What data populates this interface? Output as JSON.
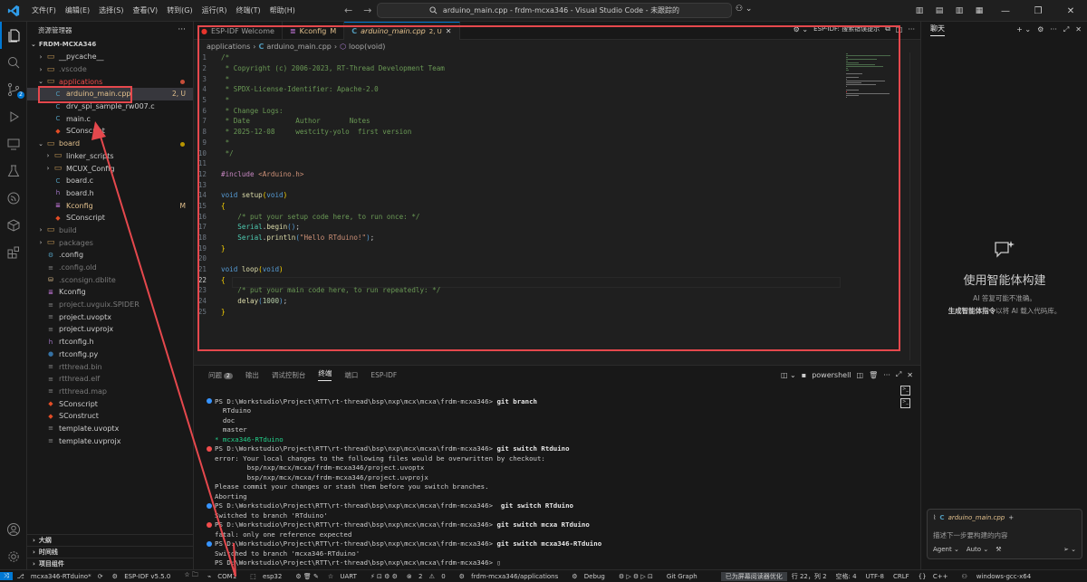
{
  "titlebar": {
    "menus": [
      "文件(F)",
      "编辑(E)",
      "选择(S)",
      "查看(V)",
      "转到(G)",
      "运行(R)",
      "终端(T)",
      "帮助(H)"
    ],
    "command_center": "arduino_main.cpp - frdm-mcxa346 - Visual Studio Code - 未跟踪的"
  },
  "activity": {
    "source_control_badge": "2"
  },
  "sidebar": {
    "title": "资源管理器",
    "root": "FRDM-MCXA346",
    "items": [
      {
        "label": "__pycache__",
        "indent": 1,
        "type": "folder",
        "expanded": false,
        "status": ""
      },
      {
        "label": ".vscode",
        "indent": 1,
        "type": "folder",
        "expanded": false,
        "status": "",
        "dim": true
      },
      {
        "label": "applications",
        "indent": 1,
        "type": "folder",
        "expanded": true,
        "status": "",
        "color": "#f14c4c"
      },
      {
        "label": "arduino_main.cpp",
        "indent": 2,
        "type": "cpp",
        "status": "2, U",
        "color": "#e2c08d",
        "selected": true
      },
      {
        "label": "drv_spi_sample_rw007.c",
        "indent": 2,
        "type": "c",
        "status": ""
      },
      {
        "label": "main.c",
        "indent": 2,
        "type": "c",
        "status": ""
      },
      {
        "label": "SConscript",
        "indent": 2,
        "type": "scons",
        "status": ""
      },
      {
        "label": "board",
        "indent": 1,
        "type": "folder",
        "expanded": true,
        "status": "",
        "color": "#e2c08d"
      },
      {
        "label": "linker_scripts",
        "indent": 2,
        "type": "folder",
        "expanded": false,
        "status": ""
      },
      {
        "label": "MCUX_Config",
        "indent": 2,
        "type": "folder",
        "expanded": false,
        "status": ""
      },
      {
        "label": "board.c",
        "indent": 2,
        "type": "c",
        "status": ""
      },
      {
        "label": "board.h",
        "indent": 2,
        "type": "h",
        "status": ""
      },
      {
        "label": "Kconfig",
        "indent": 2,
        "type": "kconfig",
        "status": "M",
        "color": "#e2c08d"
      },
      {
        "label": "SConscript",
        "indent": 2,
        "type": "scons",
        "status": ""
      },
      {
        "label": "build",
        "indent": 1,
        "type": "folder",
        "expanded": false,
        "status": "",
        "dim": true
      },
      {
        "label": "packages",
        "indent": 1,
        "type": "folder",
        "expanded": false,
        "status": "",
        "dim": true
      },
      {
        "label": ".config",
        "indent": 1,
        "type": "gear",
        "status": ""
      },
      {
        "label": ".config.old",
        "indent": 1,
        "type": "file",
        "status": "",
        "dim": true
      },
      {
        "label": ".sconsign.dblite",
        "indent": 1,
        "type": "db",
        "status": "",
        "dim": true
      },
      {
        "label": "Kconfig",
        "indent": 1,
        "type": "kconfig",
        "status": ""
      },
      {
        "label": "project.uvguix.SPIDER",
        "indent": 1,
        "type": "file",
        "status": "",
        "dim": true
      },
      {
        "label": "project.uvoptx",
        "indent": 1,
        "type": "file",
        "status": ""
      },
      {
        "label": "project.uvprojx",
        "indent": 1,
        "type": "file",
        "status": ""
      },
      {
        "label": "rtconfig.h",
        "indent": 1,
        "type": "h",
        "status": ""
      },
      {
        "label": "rtconfig.py",
        "indent": 1,
        "type": "py",
        "status": ""
      },
      {
        "label": "rtthread.bin",
        "indent": 1,
        "type": "file",
        "status": "",
        "dim": true
      },
      {
        "label": "rtthread.elf",
        "indent": 1,
        "type": "file",
        "status": "",
        "dim": true
      },
      {
        "label": "rtthread.map",
        "indent": 1,
        "type": "file",
        "status": "",
        "dim": true
      },
      {
        "label": "SConscript",
        "indent": 1,
        "type": "scons",
        "status": ""
      },
      {
        "label": "SConstruct",
        "indent": 1,
        "type": "scons",
        "status": ""
      },
      {
        "label": "template.uvoptx",
        "indent": 1,
        "type": "file",
        "status": ""
      },
      {
        "label": "template.uvprojx",
        "indent": 1,
        "type": "file",
        "status": ""
      }
    ],
    "bottom_sections": [
      "大纲",
      "时间线",
      "项目组件"
    ]
  },
  "tabs": [
    {
      "label": "ESP-IDF Welcome",
      "icon": "esp-icon",
      "active": false,
      "status": ""
    },
    {
      "label": "Kconfig",
      "icon": "kconfig-icon",
      "active": false,
      "status": "M"
    },
    {
      "label": "arduino_main.cpp",
      "icon": "cpp-icon",
      "active": true,
      "status": "2, U"
    }
  ],
  "tab_actions": {
    "esp_hint": "ESP-IDF: 搜索错误提示"
  },
  "breadcrumb": {
    "folder": "applications",
    "file": "arduino_main.cpp",
    "symbol": "loop(void)"
  },
  "code": [
    [
      [
        "c-com",
        "/*"
      ]
    ],
    [
      [
        "c-com",
        " * Copyright (c) 2006-2023, RT-Thread Development Team"
      ]
    ],
    [
      [
        "c-com",
        " *"
      ]
    ],
    [
      [
        "c-com",
        " * SPDX-License-Identifier: Apache-2.0"
      ]
    ],
    [
      [
        "c-com",
        " *"
      ]
    ],
    [
      [
        "c-com",
        " * Change Logs:"
      ]
    ],
    [
      [
        "c-com",
        " * Date           Author       Notes"
      ]
    ],
    [
      [
        "c-com",
        " * 2025-12-08     westcity-yolo  first version"
      ]
    ],
    [
      [
        "c-com",
        " *"
      ]
    ],
    [
      [
        "c-com",
        " */"
      ]
    ],
    [],
    [
      [
        "c-inc",
        "#include "
      ],
      [
        "c-str",
        "<Arduino.h>"
      ]
    ],
    [],
    [
      [
        "c-kw",
        "void "
      ],
      [
        "c-fn",
        "setup"
      ],
      [
        "c-paren",
        "("
      ],
      [
        "c-kw",
        "void"
      ],
      [
        "c-paren",
        ")"
      ]
    ],
    [
      [
        "c-paren",
        "{"
      ]
    ],
    [
      [
        "",
        "    "
      ],
      [
        "c-com",
        "/* put your setup code here, to run once: */"
      ]
    ],
    [
      [
        "",
        "    "
      ],
      [
        "c-obj",
        "Serial"
      ],
      [
        "",
        "."
      ],
      [
        "c-fn",
        "begin"
      ],
      [
        "c-kw",
        "()"
      ],
      [
        "",
        ";"
      ]
    ],
    [
      [
        "",
        "    "
      ],
      [
        "c-obj",
        "Serial"
      ],
      [
        "",
        "."
      ],
      [
        "c-fn",
        "println"
      ],
      [
        "c-kw",
        "("
      ],
      [
        "c-str",
        "\"Hello RTduino!\""
      ],
      [
        "c-kw",
        ")"
      ],
      [
        "",
        ";"
      ]
    ],
    [
      [
        "c-paren",
        "}"
      ]
    ],
    [],
    [
      [
        "c-kw",
        "void "
      ],
      [
        "c-fn",
        "loop"
      ],
      [
        "c-paren",
        "("
      ],
      [
        "c-kw",
        "void"
      ],
      [
        "c-paren",
        ")"
      ]
    ],
    [
      [
        "c-paren",
        "{"
      ]
    ],
    [
      [
        "",
        "    "
      ],
      [
        "c-com",
        "/* put your main code here, to run repeatedly: */"
      ]
    ],
    [
      [
        "",
        "    "
      ],
      [
        "c-fn",
        "delay"
      ],
      [
        "c-kw",
        "("
      ],
      [
        "c-num",
        "1000"
      ],
      [
        "c-kw",
        ")"
      ],
      [
        "",
        ";"
      ]
    ],
    [
      [
        "c-paren",
        "}"
      ]
    ]
  ],
  "current_line": 22,
  "panel": {
    "tabs": [
      {
        "label": "问题",
        "badge": "2"
      },
      {
        "label": "输出",
        "badge": ""
      },
      {
        "label": "调试控制台",
        "badge": ""
      },
      {
        "label": "终端",
        "badge": "",
        "active": true
      },
      {
        "label": "端口",
        "badge": ""
      },
      {
        "label": "ESP-IDF",
        "badge": ""
      }
    ],
    "shell": "powershell"
  },
  "terminal": [
    {
      "bullet": "blue",
      "prompt": "PS D:\\Workstudio\\Project\\RTT\\rt-thread\\bsp\\nxp\\mcx\\mcxa\\frdm-mcxa346> ",
      "cmd": "git branch"
    },
    {
      "bullet": "",
      "text": "  RTduino"
    },
    {
      "bullet": "",
      "text": "  doc"
    },
    {
      "bullet": "",
      "text": "  master"
    },
    {
      "bullet": "",
      "text": "* mcxa346-RTduino",
      "green": true
    },
    {
      "bullet": "red",
      "prompt": "PS D:\\Workstudio\\Project\\RTT\\rt-thread\\bsp\\nxp\\mcx\\mcxa\\frdm-mcxa346> ",
      "cmd": "git switch Rtduino"
    },
    {
      "bullet": "",
      "text": "error: Your local changes to the following files would be overwritten by checkout:"
    },
    {
      "bullet": "",
      "text": "        bsp/nxp/mcx/mcxa/frdm-mcxa346/project.uvoptx"
    },
    {
      "bullet": "",
      "text": "        bsp/nxp/mcx/mcxa/frdm-mcxa346/project.uvprojx"
    },
    {
      "bullet": "",
      "text": "Please commit your changes or stash them before you switch branches."
    },
    {
      "bullet": "",
      "text": "Aborting"
    },
    {
      "bullet": "blue",
      "prompt": "PS D:\\Workstudio\\Project\\RTT\\rt-thread\\bsp\\nxp\\mcx\\mcxa\\frdm-mcxa346> ",
      "cmd": " git switch RTduino"
    },
    {
      "bullet": "",
      "text": "Switched to branch 'RTduino'"
    },
    {
      "bullet": "red",
      "prompt": "PS D:\\Workstudio\\Project\\RTT\\rt-thread\\bsp\\nxp\\mcx\\mcxa\\frdm-mcxa346> ",
      "cmd": "git switch mcxa RTduino"
    },
    {
      "bullet": "",
      "text": "fatal: only one reference expected"
    },
    {
      "bullet": "blue",
      "prompt": "PS D:\\Workstudio\\Project\\RTT\\rt-thread\\bsp\\nxp\\mcx\\mcxa\\frdm-mcxa346> ",
      "cmd": "git switch mcxa346-RTduino"
    },
    {
      "bullet": "",
      "text": "Switched to branch 'mcxa346-RTduino'"
    },
    {
      "bullet": "",
      "text": "PS D:\\Workstudio\\Project\\RTT\\rt-thread\\bsp\\nxp\\mcx\\mcxa\\frdm-mcxa346> ▯"
    }
  ],
  "chat": {
    "title": "聊天",
    "empty_title": "使用智能体构建",
    "empty_sub": "AI 答复可能不准确。",
    "empty_sub2_bold": "生成智能体指令",
    "empty_sub2_rest": "以将 AI 载入代码库。",
    "context_file": "arduino_main.cpp",
    "placeholder": "描述下一步要构建的内容",
    "mode": "Agent",
    "model": "Auto"
  },
  "statusbar": {
    "branch": "mcxa346-RTduino*",
    "idf": "ESP-IDF v5.5.0",
    "com": "COM1",
    "target": "esp32",
    "flash": "UART",
    "errors": "2",
    "warnings": "0",
    "folder": "frdm-mcxa346/applications",
    "debug": "Debug",
    "git_graph": "Git Graph",
    "screen_reader": "已为屏幕阅读器优化",
    "position": "行 22，列 2",
    "spaces": "空格: 4",
    "encoding": "UTF-8",
    "eol": "CRLF",
    "language": "C++",
    "config": "windows-gcc-x64"
  },
  "colors": {
    "annotation": "#e5484d",
    "accent": "#0078d4"
  }
}
